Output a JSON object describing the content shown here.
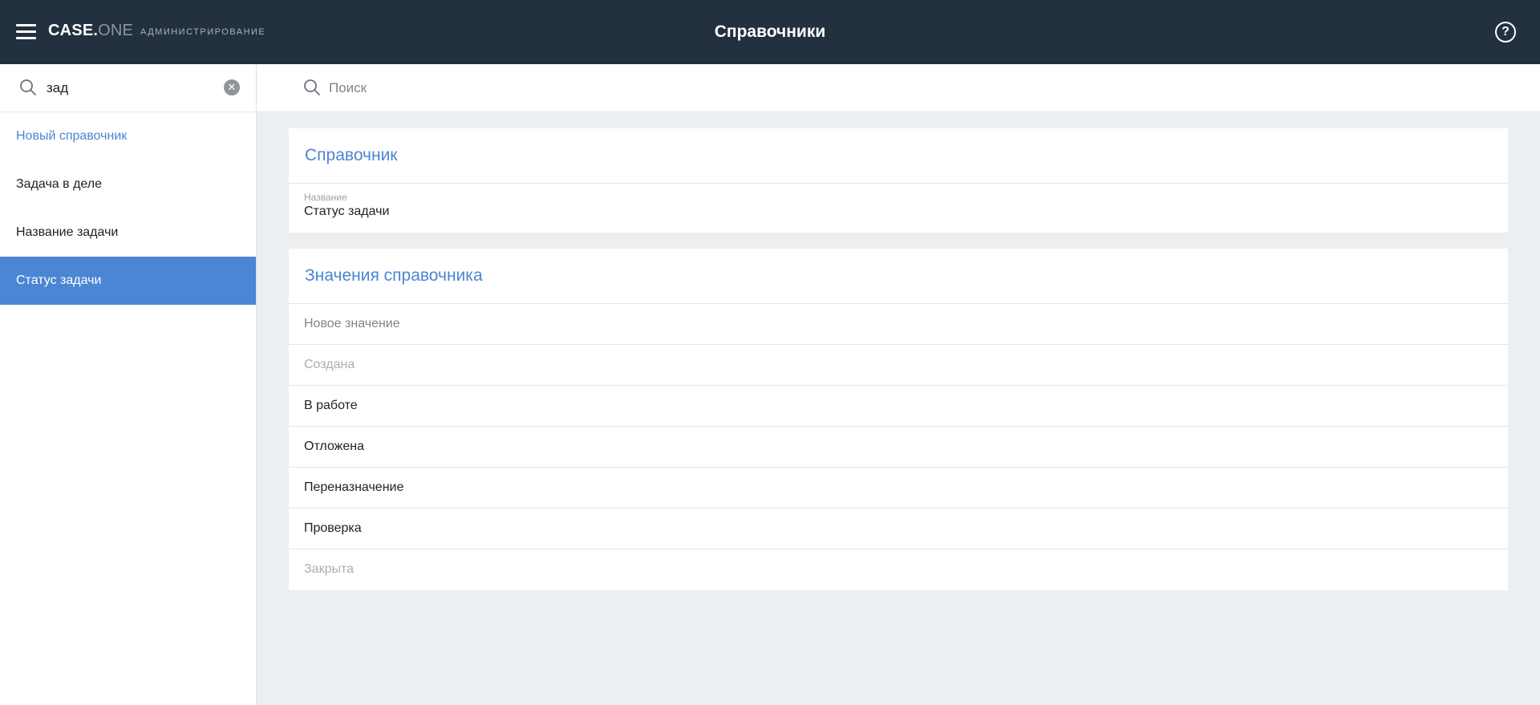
{
  "header": {
    "brand_main": "CASE.",
    "brand_accent": "ONE",
    "section": "АДМИНИСТРИРОВАНИЕ",
    "title": "Справочники",
    "help_icon": "?"
  },
  "sidebar": {
    "search_value": "зад",
    "clear_icon": "✕",
    "new_item": "Новый справочник",
    "items": [
      {
        "label": "Задача в деле"
      },
      {
        "label": "Название задачи"
      },
      {
        "label": "Статус задачи"
      }
    ]
  },
  "main": {
    "search_placeholder": "Поиск",
    "directory_card": {
      "title": "Справочник",
      "name_label": "Название",
      "name_value": "Статус задачи"
    },
    "values_card": {
      "title": "Значения справочника",
      "new_value": "Новое значение",
      "values": [
        {
          "label": "Создана"
        },
        {
          "label": "В работе"
        },
        {
          "label": "Отложена"
        },
        {
          "label": "Переназначение"
        },
        {
          "label": "Проверка"
        },
        {
          "label": "Закрыта"
        }
      ]
    }
  },
  "colors": {
    "topbar": "#23303f",
    "accent": "#4a86d4",
    "background": "#eceff1"
  }
}
